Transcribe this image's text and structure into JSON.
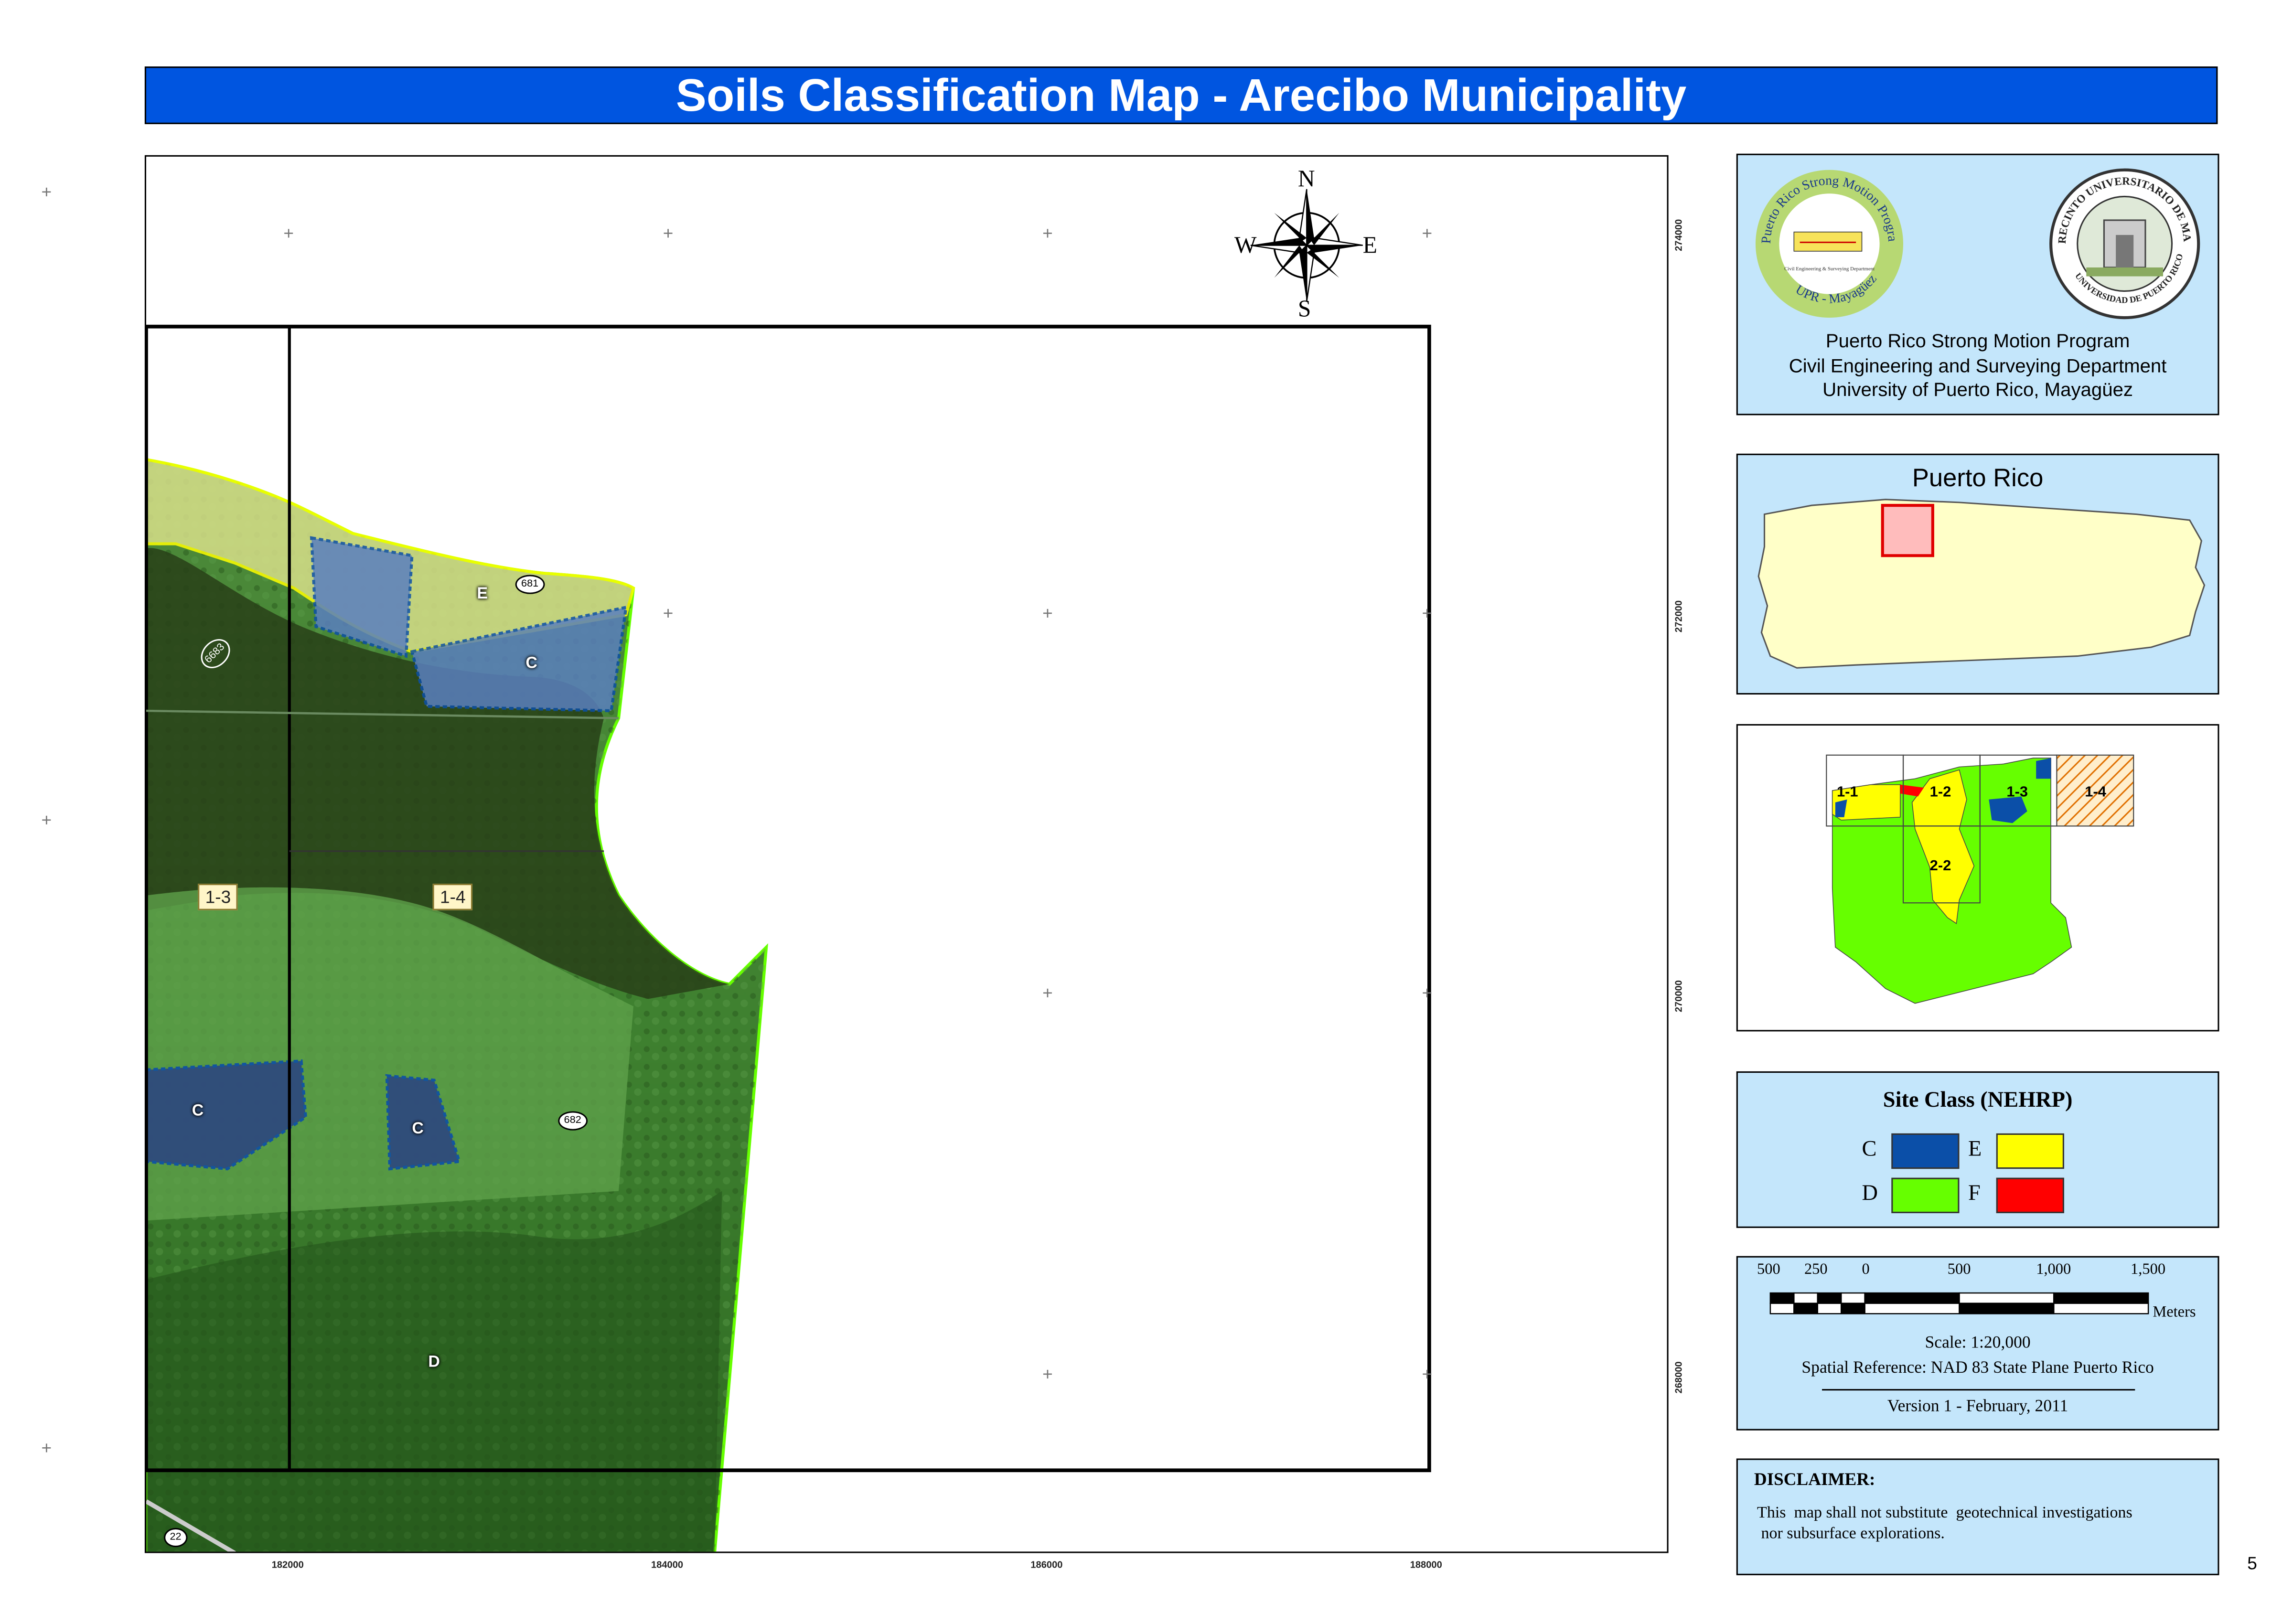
{
  "title": "Soils Classification Map - Arecibo Municipality",
  "colors": {
    "title_bg": "#0055e0",
    "panel_bg": "#c4e6fb",
    "class_C": "#0b4fa8",
    "class_D": "#66ff00",
    "class_E": "#ffff00",
    "class_F": "#ff0000",
    "island_fill": "#ffffc8",
    "highlight": "#ffbcbc"
  },
  "map": {
    "compass": {
      "n": "N",
      "s": "S",
      "e": "E",
      "w": "W"
    },
    "x_coords": [
      "182000",
      "184000",
      "186000",
      "188000"
    ],
    "y_coords": [
      "274000",
      "272000",
      "270000",
      "268000"
    ],
    "quad_labels": {
      "q13": "1-3",
      "q14": "1-4"
    },
    "road_labels": {
      "r681": "681",
      "r682": "682",
      "r6683": "6683",
      "r22": "22"
    },
    "soil_letters": {
      "e": "E",
      "c1": "C",
      "c2": "C",
      "c3": "C",
      "d": "D"
    }
  },
  "logos": {
    "left_text": "Puerto Rico Strong Motion Program",
    "left_bottom": "UPR - Mayagüez",
    "left_inner": "Civil Engineering & Surveying Department",
    "right_text": "RECINTO UNIVERSITARIO DE MAYAGÜEZ",
    "right_bottom": "UNIVERSIDAD DE PUERTO RICO"
  },
  "org": {
    "line1": "Puerto Rico Strong Motion Program",
    "line2": "Civil Engineering and Surveying Department",
    "line3": "University of Puerto Rico, Mayagüez"
  },
  "locator": {
    "title": "Puerto Rico"
  },
  "index_map": {
    "labels": [
      "1-1",
      "1-2",
      "1-3",
      "1-4",
      "2-2"
    ]
  },
  "legend": {
    "title": "Site Class (NEHRP)",
    "items": [
      {
        "letter": "C",
        "color": "#0b4fa8"
      },
      {
        "letter": "E",
        "color": "#ffff00"
      },
      {
        "letter": "D",
        "color": "#66ff00"
      },
      {
        "letter": "F",
        "color": "#ff0000"
      }
    ]
  },
  "scale": {
    "ticks": [
      "500",
      "250",
      "0",
      "500",
      "1,000",
      "1,500"
    ],
    "unit": "Meters",
    "scale_text": "Scale:  1:20,000",
    "spatial_ref": "Spatial Reference: NAD 83 State Plane Puerto Rico",
    "version": "Version 1 - February, 2011"
  },
  "disclaimer": {
    "title": "DISCLAIMER:",
    "line1": "This  map shall not substitute  geotechnical investigations",
    "line2": " nor subsurface explorations."
  },
  "page_number": "5"
}
